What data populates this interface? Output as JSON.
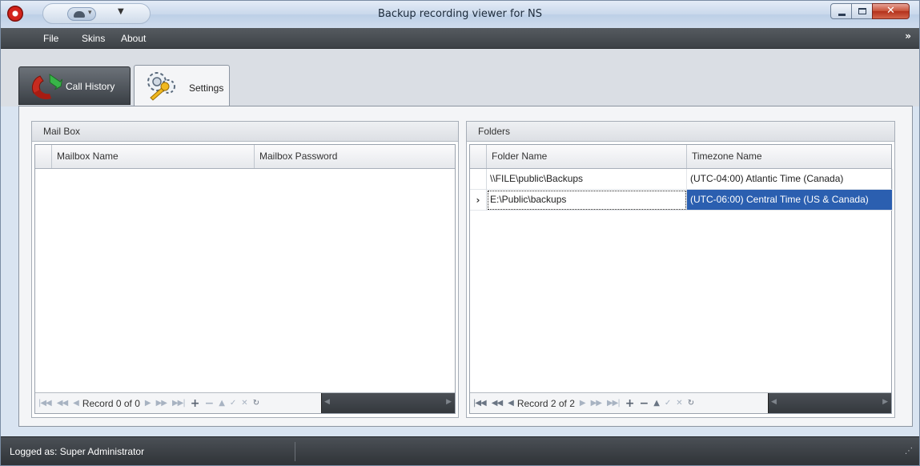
{
  "window": {
    "title": "Backup recording viewer for NS",
    "controls": {
      "minimize": "minimize-icon",
      "maximize": "maximize-icon",
      "close": "✕"
    }
  },
  "quick_access": {
    "customize_glyph": "▼"
  },
  "menu": {
    "items": [
      {
        "label": "File"
      },
      {
        "label": "Skins"
      },
      {
        "label": "About"
      }
    ],
    "expand_glyph": "»"
  },
  "tabs": [
    {
      "label": "Call History",
      "icon": "phone-icon",
      "active": false
    },
    {
      "label": "Settings",
      "icon": "gear-wrench-icon",
      "active": true
    }
  ],
  "mailbox": {
    "title": "Mail Box",
    "columns": [
      "Mailbox Name",
      "Mailbox Password"
    ],
    "rows": [],
    "navigator": {
      "record_text": "Record 0 of 0"
    }
  },
  "folders": {
    "title": "Folders",
    "columns": [
      "Folder Name",
      "Timezone Name"
    ],
    "rows": [
      {
        "folder": "\\\\FILE\\public\\Backups",
        "timezone": "(UTC-04:00) Atlantic Time (Canada)",
        "current": false
      },
      {
        "folder": "E:\\Public\\backups",
        "timezone": "(UTC-06:00) Central Time (US & Canada)",
        "current": true
      }
    ],
    "current_row_glyph": "›",
    "navigator": {
      "record_text": "Record 2 of 2"
    }
  },
  "navigator_glyphs": {
    "first": "⏮",
    "prev_page": "◀◀",
    "prev": "◀",
    "next": "▶",
    "next_page": "▶▶",
    "last": "⏭",
    "append": "+",
    "delete": "−",
    "edit": "▲",
    "post": "✓",
    "cancel": "✕",
    "refresh": "↻"
  },
  "statusbar": {
    "text": "Logged as: Super Administrator",
    "grip": "⋰"
  },
  "colors": {
    "selection": "#2b5fb0",
    "menubar": "#45494e",
    "window_frame": "#c9d8eb"
  }
}
